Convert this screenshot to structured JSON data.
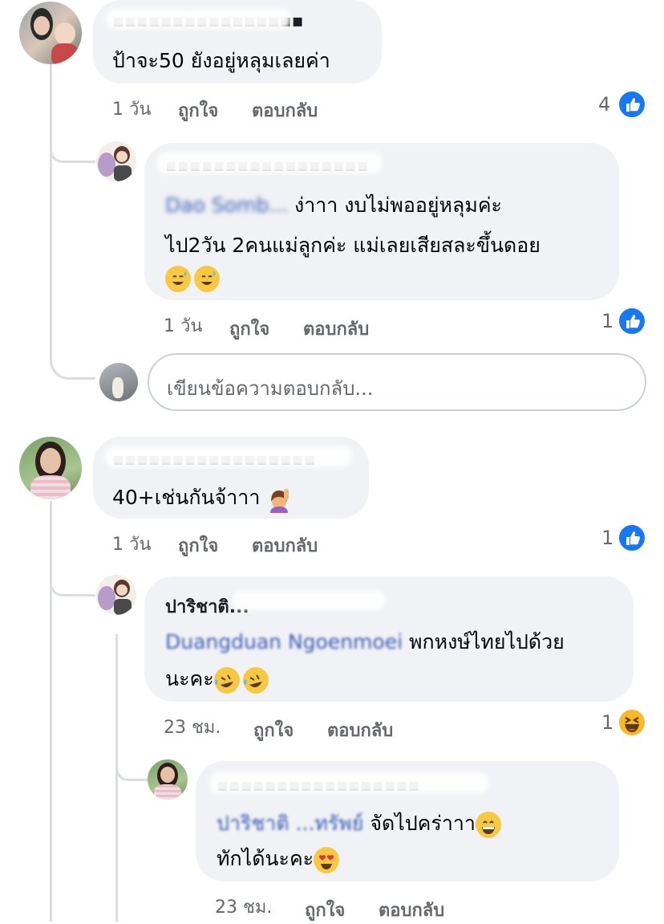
{
  "comments": [
    {
      "text": "ป้าจะ50 ยังอยู่หลุมเลยค่า",
      "time": "1 วัน",
      "like_label": "ถูกใจ",
      "reply_label": "ตอบกลับ",
      "reactions": "4",
      "reaction_icon": "like-icon"
    },
    {
      "mention": "Dao Somb...",
      "text_line1": "ง่าาา  งบไม่พออยู่หลุมค่ะ",
      "text_line2": "ไป2วัน 2คนแม่ลูกค่ะ  แม่เลยเสียสละขึ้นดอย",
      "emoji": "😅😅",
      "time": "1 วัน",
      "like_label": "ถูกใจ",
      "reply_label": "ตอบกลับ",
      "reactions": "1",
      "reaction_icon": "like-icon"
    },
    {
      "text": "40+เช่นกันจ้าาา",
      "emoji": "🙋",
      "time": "1 วัน",
      "like_label": "ถูกใจ",
      "reply_label": "ตอบกลับ",
      "reactions": "1",
      "reaction_icon": "like-icon"
    },
    {
      "name": "ปาริชาติ...",
      "mention": "Duangduan Ngoenmoei",
      "text_line1": "พกหงษ์ไทยไปด้วย",
      "text_line2": "นะคะ",
      "emoji": "🤣🤣",
      "time": "23 ชม.",
      "like_label": "ถูกใจ",
      "reply_label": "ตอบกลับ",
      "reactions": "1",
      "reaction_icon": "haha-icon"
    },
    {
      "mention": "ปาริชาติ ...ทรัพย์",
      "text_line1": "จัดไปคร่าาา",
      "text_line2": "ทักได้นะคะ",
      "emoji1": "😄",
      "emoji2": "😍",
      "time": "23 ชม.",
      "like_label": "ถูกใจ",
      "reply_label": "ตอบกลับ"
    }
  ],
  "reply_input": {
    "placeholder": "เขียนข้อความตอบกลับ..."
  },
  "colors": {
    "bubble": "#f0f2f5",
    "mention": "#3b5db7",
    "meta": "#65676b",
    "like": "#1877f2"
  }
}
